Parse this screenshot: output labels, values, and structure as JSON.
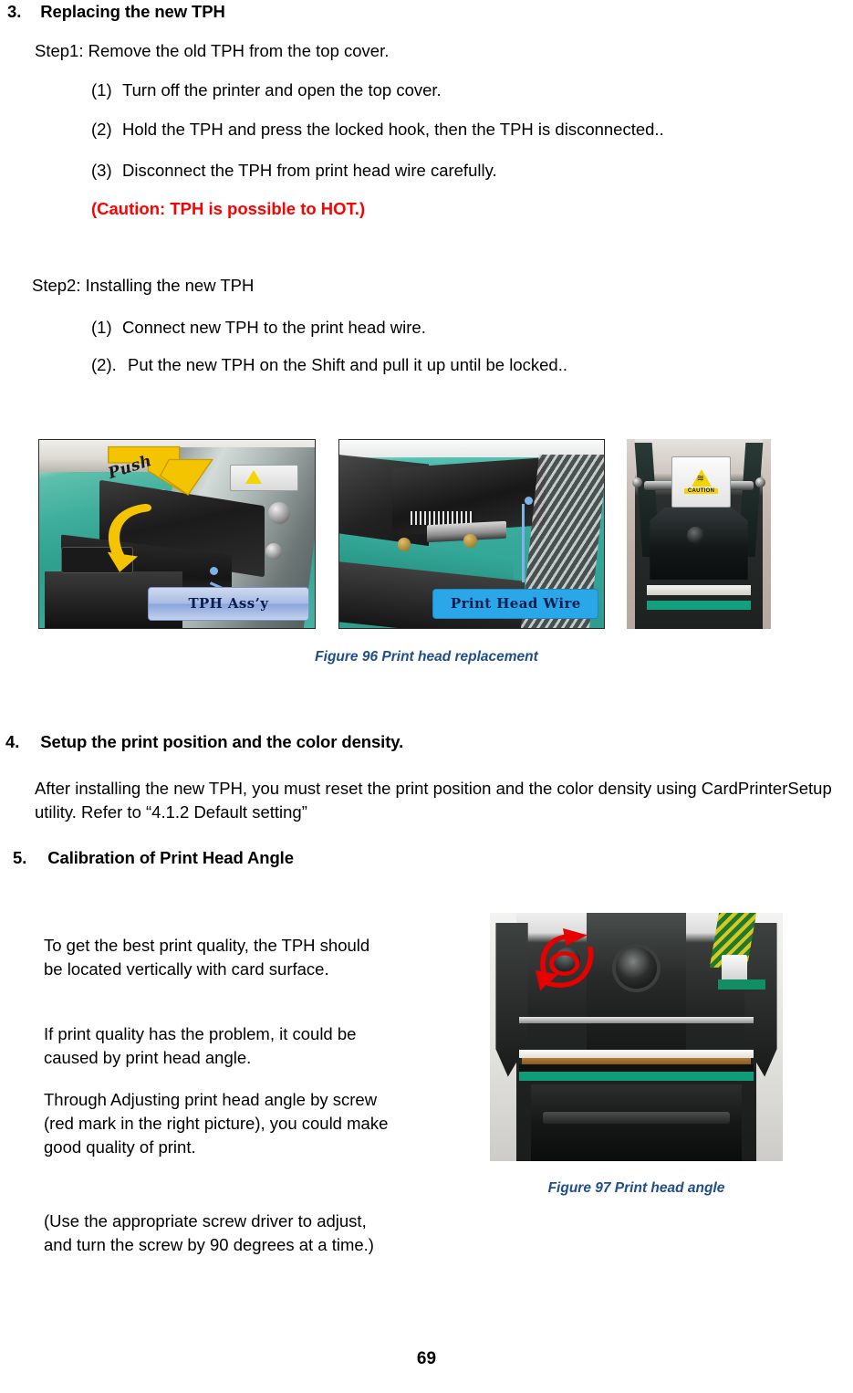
{
  "document": {
    "page_number": "69"
  },
  "sections": {
    "s3": {
      "number": "3.",
      "title": "Replacing the new TPH",
      "step1_label": "Step1: Remove the old TPH from the top cover.",
      "step1_items": [
        {
          "marker": "(1)",
          "text": "Turn off the printer and open the top cover."
        },
        {
          "marker": "(2)",
          "text": "Hold the TPH and press the locked hook, then the TPH is disconnected.."
        },
        {
          "marker": "(3)",
          "text": "Disconnect the TPH from print head wire carefully."
        }
      ],
      "caution": "(Caution: TPH is possible to HOT.)",
      "caution_color": "#FF0000",
      "step2_label": "Step2: Installing the new TPH",
      "step2_items": [
        {
          "marker": "(1)",
          "text": "Connect new TPH to the print head wire."
        },
        {
          "marker": "(2).",
          "text": "Put the new TPH on the Shift and pull it up until be locked.."
        }
      ]
    },
    "s4": {
      "number": "4.",
      "title": "Setup the print position and the color density.",
      "body": "After installing the new TPH, you must reset the print position and the color density using CardPrinterSetup utility. Refer to “4.1.2 Default setting”"
    },
    "s5": {
      "number": "5.",
      "title": "Calibration of Print Head Angle",
      "paragraphs": [
        "To get the best print quality, the TPH should be located vertically with card surface.",
        "If print quality has the problem, it could be caused by print head angle.",
        "Through Adjusting print head angle by screw (red mark in the right picture), you could make good quality of print.",
        "(Use the appropriate screw driver to adjust, and turn the screw by 90 degrees at a time.)"
      ]
    }
  },
  "figures": {
    "fig96": {
      "caption": "Figure 96 Print head replacement",
      "caption_color": "#1F4E8C",
      "photos": [
        {
          "name": "tph-assembly-photo",
          "annotations": {
            "arrow_label": "Push",
            "callout_label": "TPH Ass’y"
          }
        },
        {
          "name": "print-head-wire-photo",
          "annotations": {
            "callout_label": "Print Head  Wire"
          }
        },
        {
          "name": "tph-caution-label-photo",
          "annotations": {
            "sticker_label": "CAUTION"
          }
        }
      ]
    },
    "fig97": {
      "caption": "Figure 97 Print head angle",
      "caption_color": "#1F4E8C",
      "photo": {
        "name": "print-head-angle-photo",
        "mark_color": "#E60000"
      }
    }
  }
}
